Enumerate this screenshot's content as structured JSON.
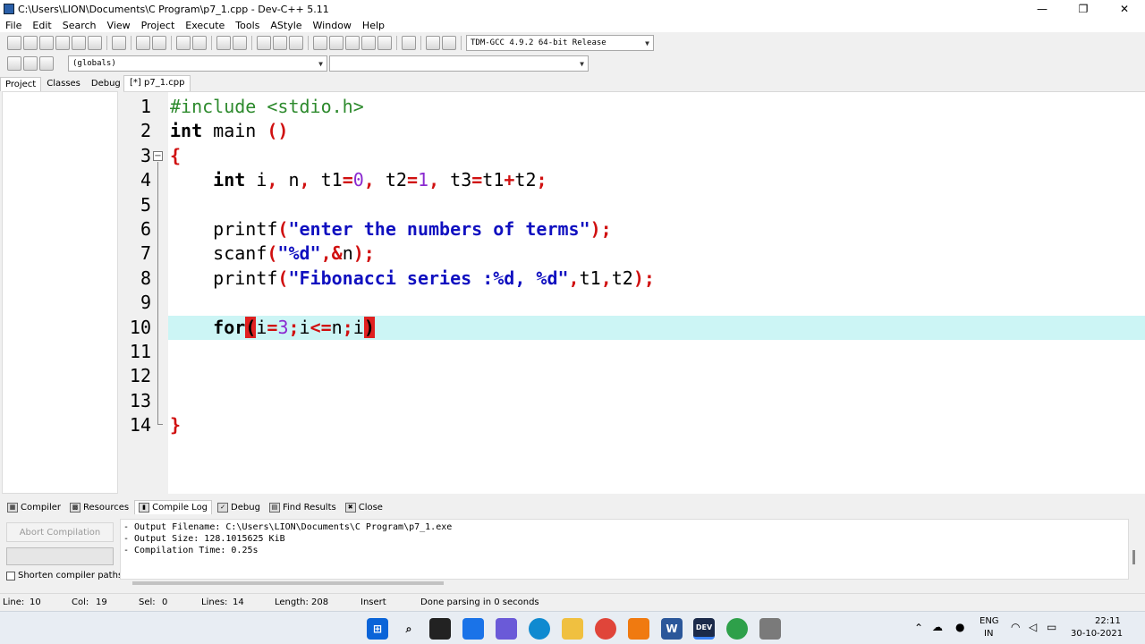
{
  "window": {
    "title": "C:\\Users\\LION\\Documents\\C Program\\p7_1.cpp - Dev-C++ 5.11",
    "min_glyph": "—",
    "max_glyph": "❐",
    "close_glyph": "✕"
  },
  "menu": [
    "File",
    "Edit",
    "Search",
    "View",
    "Project",
    "Execute",
    "Tools",
    "AStyle",
    "Window",
    "Help"
  ],
  "toolbar": {
    "compiler_select": "TDM-GCC 4.9.2 64-bit Release",
    "scope_select": "(globals)",
    "member_select": ""
  },
  "left_tabs": [
    "Project",
    "Classes",
    "Debug"
  ],
  "editor": {
    "file_tab": "[*] p7_1.cpp",
    "line_numbers": [
      "1",
      "2",
      "3",
      "4",
      "5",
      "6",
      "7",
      "8",
      "9",
      "10",
      "11",
      "12",
      "13",
      "14"
    ],
    "fold_glyph": "−",
    "lines": [
      [
        {
          "c": "p",
          "t": "#include <stdio.h>"
        }
      ],
      [
        {
          "c": "k",
          "t": "int"
        },
        {
          "c": "t",
          "t": " main "
        },
        {
          "c": "o",
          "t": "()"
        }
      ],
      [
        {
          "c": "o",
          "t": "{"
        }
      ],
      [
        {
          "c": "t",
          "t": "    "
        },
        {
          "c": "k",
          "t": "int"
        },
        {
          "c": "t",
          "t": " i"
        },
        {
          "c": "o",
          "t": ","
        },
        {
          "c": "t",
          "t": " n"
        },
        {
          "c": "o",
          "t": ","
        },
        {
          "c": "t",
          "t": " t1"
        },
        {
          "c": "o",
          "t": "="
        },
        {
          "c": "n",
          "t": "0"
        },
        {
          "c": "o",
          "t": ","
        },
        {
          "c": "t",
          "t": " t2"
        },
        {
          "c": "o",
          "t": "="
        },
        {
          "c": "n",
          "t": "1"
        },
        {
          "c": "o",
          "t": ","
        },
        {
          "c": "t",
          "t": " t3"
        },
        {
          "c": "o",
          "t": "="
        },
        {
          "c": "t",
          "t": "t1"
        },
        {
          "c": "o",
          "t": "+"
        },
        {
          "c": "t",
          "t": "t2"
        },
        {
          "c": "o",
          "t": ";"
        }
      ],
      [],
      [
        {
          "c": "t",
          "t": "    printf"
        },
        {
          "c": "o",
          "t": "("
        },
        {
          "c": "s",
          "t": "\"enter the numbers of terms\""
        },
        {
          "c": "o",
          "t": ");"
        }
      ],
      [
        {
          "c": "t",
          "t": "    scanf"
        },
        {
          "c": "o",
          "t": "("
        },
        {
          "c": "s",
          "t": "\"%d\""
        },
        {
          "c": "o",
          "t": ",&"
        },
        {
          "c": "t",
          "t": "n"
        },
        {
          "c": "o",
          "t": ");"
        }
      ],
      [
        {
          "c": "t",
          "t": "    printf"
        },
        {
          "c": "o",
          "t": "("
        },
        {
          "c": "s",
          "t": "\"Fibonacci series :%d, %d\""
        },
        {
          "c": "o",
          "t": ","
        },
        {
          "c": "t",
          "t": "t1"
        },
        {
          "c": "o",
          "t": ","
        },
        {
          "c": "t",
          "t": "t2"
        },
        {
          "c": "o",
          "t": ");"
        }
      ],
      [],
      [
        {
          "c": "t",
          "t": "    "
        },
        {
          "c": "k",
          "t": "for"
        },
        {
          "c": "br",
          "t": "("
        },
        {
          "c": "t",
          "t": "i"
        },
        {
          "c": "o",
          "t": "="
        },
        {
          "c": "n",
          "t": "3"
        },
        {
          "c": "o",
          "t": ";"
        },
        {
          "c": "t",
          "t": "i"
        },
        {
          "c": "o",
          "t": "<="
        },
        {
          "c": "t",
          "t": "n"
        },
        {
          "c": "o",
          "t": ";"
        },
        {
          "c": "t",
          "t": "i"
        },
        {
          "c": "br",
          "t": ")"
        }
      ],
      [],
      [],
      [],
      [
        {
          "c": "o",
          "t": "}"
        }
      ]
    ]
  },
  "bottom_tabs": [
    "Compiler",
    "Resources",
    "Compile Log",
    "Debug",
    "Find Results",
    "Close"
  ],
  "bottom_tab_icons": [
    "▦",
    "▩",
    "▮",
    "✓",
    "▤",
    "✖"
  ],
  "compile": {
    "abort_label": "Abort Compilation",
    "shorten_label": "Shorten compiler paths",
    "log": [
      "- Output Filename: C:\\Users\\LION\\Documents\\C Program\\p7_1.exe",
      "- Output Size: 128.1015625 KiB",
      "- Compilation Time: 0.25s"
    ]
  },
  "status": {
    "line_label": "Line:",
    "line": "10",
    "col_label": "Col:",
    "col": "19",
    "sel_label": "Sel:",
    "sel": "0",
    "lines_label": "Lines:",
    "lines": "14",
    "length_label": "Length:",
    "length": "208",
    "mode": "Insert",
    "message": "Done parsing in 0 seconds"
  },
  "taskbar": {
    "lang": "ENG",
    "region": "IN",
    "time": "22:11",
    "date": "30-10-2021",
    "devcpp_label": "DEV"
  },
  "colors": {
    "current_line": "#ccf5f5",
    "operator": "#d01010",
    "string": "#1010c0",
    "number": "#8a2ad0",
    "preprocessor": "#2d8a2d"
  }
}
